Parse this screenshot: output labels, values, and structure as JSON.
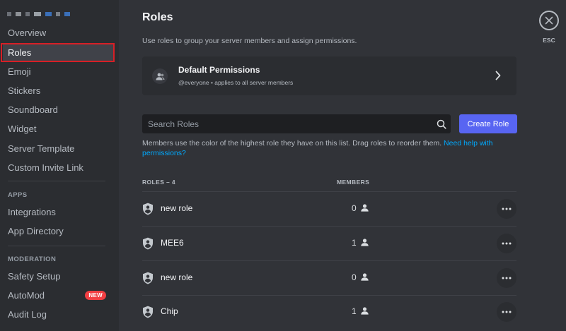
{
  "sidebar": {
    "items": [
      {
        "label": "Overview"
      },
      {
        "label": "Roles"
      },
      {
        "label": "Emoji"
      },
      {
        "label": "Stickers"
      },
      {
        "label": "Soundboard"
      },
      {
        "label": "Widget"
      },
      {
        "label": "Server Template"
      },
      {
        "label": "Custom Invite Link"
      }
    ],
    "apps_header": "APPS",
    "apps_items": [
      {
        "label": "Integrations"
      },
      {
        "label": "App Directory"
      }
    ],
    "moderation_header": "MODERATION",
    "moderation_items": [
      {
        "label": "Safety Setup"
      },
      {
        "label": "AutoMod",
        "badge": "NEW"
      },
      {
        "label": "Audit Log"
      }
    ],
    "selected": "Roles"
  },
  "main": {
    "title": "Roles",
    "subtitle": "Use roles to group your server members and assign permissions.",
    "default_permissions": {
      "title": "Default Permissions",
      "description": "@everyone • applies to all server members"
    },
    "search": {
      "placeholder": "Search Roles"
    },
    "create_button": "Create Role",
    "help_text": "Members use the color of the highest role they have on this list. Drag roles to reorder them.",
    "help_link": "Need help with permissions?",
    "columns": {
      "roles": "ROLES – 4",
      "members": "MEMBERS"
    },
    "roles": [
      {
        "name": "new role",
        "members": "0"
      },
      {
        "name": "MEE6",
        "members": "1"
      },
      {
        "name": "new role",
        "members": "0"
      },
      {
        "name": "Chip",
        "members": "1"
      }
    ]
  },
  "close": {
    "label": "ESC"
  },
  "colors": {
    "accent": "#5865f2",
    "link": "#00a8fc",
    "badge": "#f23f43",
    "highlight_box": "#d71f26",
    "sidebar_bg": "#2b2d31",
    "main_bg": "#313338"
  },
  "icons": {
    "default_permissions": "members-icon",
    "search": "search-icon",
    "chevron": "chevron-right-icon",
    "role": "shield-icon",
    "member": "person-icon",
    "more": "more-dots-icon",
    "close": "close-icon"
  }
}
